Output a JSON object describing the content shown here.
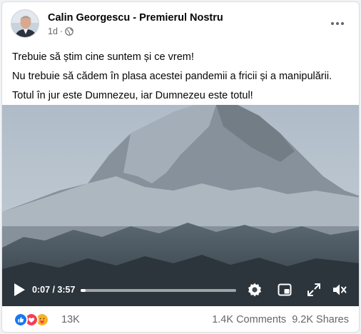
{
  "post": {
    "author": "Calin Georgescu - Premierul Nostru",
    "time_ago": "1d",
    "separator": "·",
    "privacy_icon": "globe-icon",
    "more_icon": "more-horizontal-icon",
    "text_lines": [
      "Trebuie să știm cine suntem și ce vrem!",
      "Nu trebuie să cădem în plasa acestei pandemii a fricii și a manipulării.",
      "Totul în jur este Dumnezeu, iar Dumnezeu este totul!"
    ]
  },
  "video": {
    "current_time": "0:07",
    "duration": "3:57",
    "time_display": "0:07 / 3:57",
    "progress_fraction": 0.03,
    "icons": [
      "play-icon",
      "settings-gear-icon",
      "picture-in-picture-icon",
      "fullscreen-icon",
      "volume-icon"
    ]
  },
  "engagement": {
    "reaction_icons": [
      "like-icon",
      "love-icon",
      "care-icon"
    ],
    "reactions_count": "13K",
    "comments": "1.4K Comments",
    "shares": "9.2K Shares"
  },
  "colors": {
    "text_primary": "#050505",
    "text_secondary": "#65676b",
    "like_blue": "#1877f2",
    "love_red": "#f33e58",
    "care_yellow": "#f7b125"
  }
}
